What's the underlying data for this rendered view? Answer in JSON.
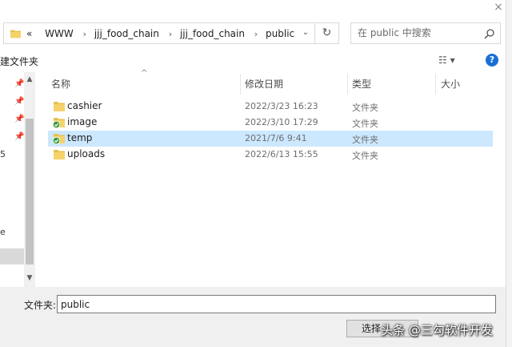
{
  "window": {
    "close_glyph": "×"
  },
  "address": {
    "overflow": "«",
    "segments": [
      "WWW",
      "jjj_food_chain",
      "jjj_food_chain",
      "public"
    ],
    "dropdown_glyph": "⌄",
    "refresh_glyph": "↻"
  },
  "search": {
    "placeholder": "在 public 中搜索"
  },
  "toolbar": {
    "new_folder_label": "建文件夹",
    "view_glyph": "☷ ▾",
    "help_glyph": "?"
  },
  "nav": {
    "clip_labels": [
      "5",
      "e"
    ]
  },
  "columns": {
    "name": "名称",
    "date": "修改日期",
    "type": "类型",
    "size": "大小"
  },
  "files": [
    {
      "name": "cashier",
      "date": "2022/3/23 16:23",
      "type": "文件夹",
      "synced": false,
      "selected": false
    },
    {
      "name": "image",
      "date": "2022/3/10 17:29",
      "type": "文件夹",
      "synced": true,
      "selected": false
    },
    {
      "name": "temp",
      "date": "2021/7/6 9:41",
      "type": "文件夹",
      "synced": true,
      "selected": true
    },
    {
      "name": "uploads",
      "date": "2022/6/13 15:55",
      "type": "文件夹",
      "synced": false,
      "selected": false
    }
  ],
  "footer": {
    "filename_label": "文件夹:",
    "filename_value": "public",
    "select_button": "选择",
    "watermark": "头条 @三勾软件开发"
  },
  "colors": {
    "selected_row": "#cce8ff",
    "folder": "#e8c050",
    "sync_check": "#3a9a3a",
    "help": "#1a6fd6"
  }
}
